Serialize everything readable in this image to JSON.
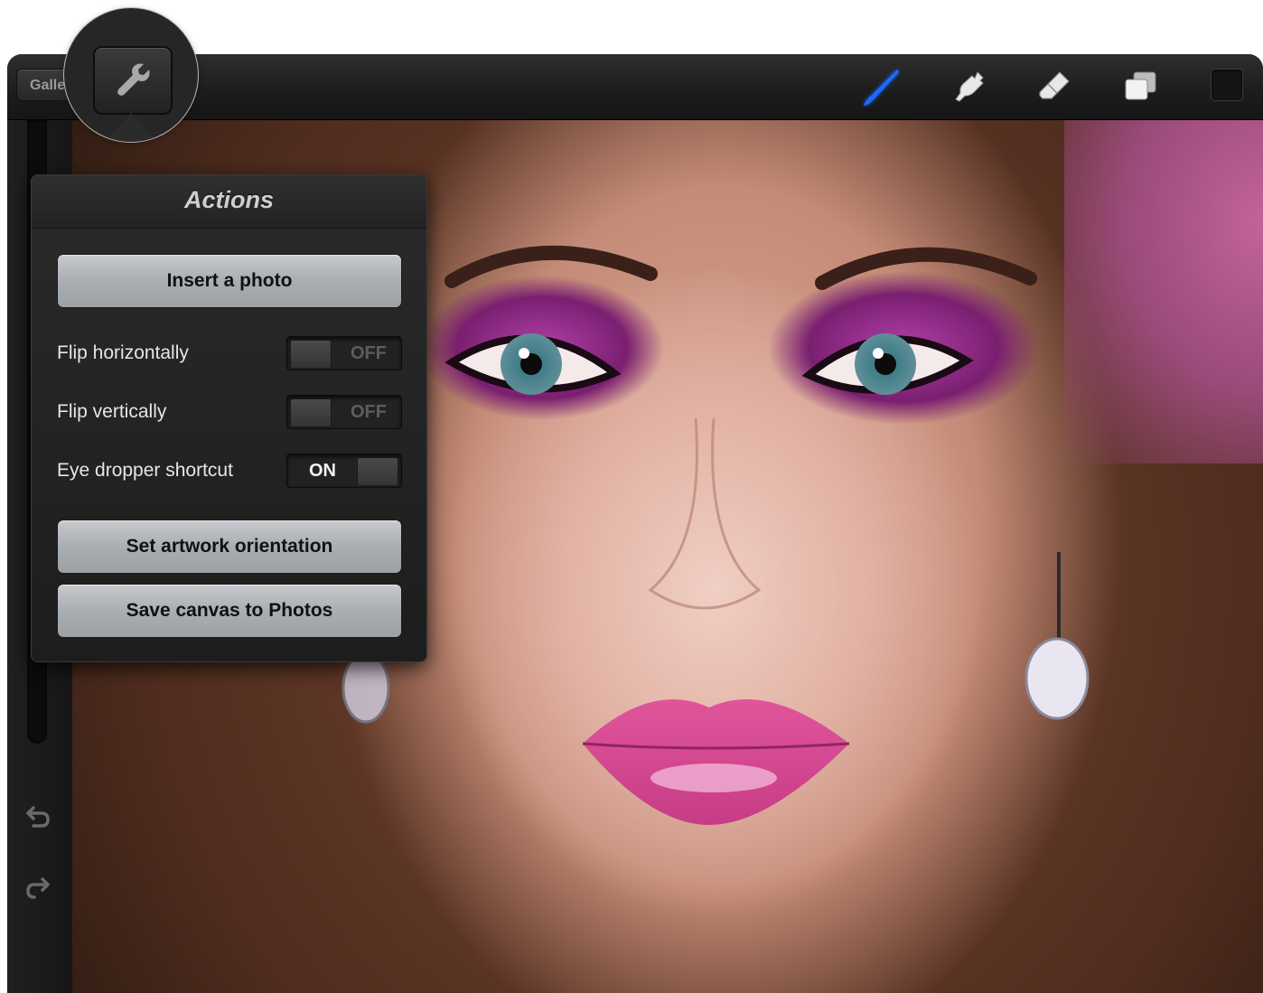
{
  "topbar": {
    "gallery_label": "Galle",
    "tools": [
      {
        "name": "brush-icon",
        "active": true
      },
      {
        "name": "smudge-icon",
        "active": false
      },
      {
        "name": "eraser-icon",
        "active": false
      },
      {
        "name": "layers-icon",
        "active": false
      }
    ],
    "accent_color": "#1e6bff"
  },
  "popover": {
    "title": "Actions",
    "insert_photo": "Insert a photo",
    "flip_horizontally": {
      "label": "Flip horizontally",
      "state": "OFF"
    },
    "flip_vertically": {
      "label": "Flip vertically",
      "state": "OFF"
    },
    "eye_dropper": {
      "label": "Eye dropper shortcut",
      "state": "ON"
    },
    "set_orientation": "Set artwork orientation",
    "save_canvas": "Save canvas to Photos"
  },
  "leftbar": {
    "undo_icon": "undo-icon",
    "redo_icon": "redo-icon"
  }
}
